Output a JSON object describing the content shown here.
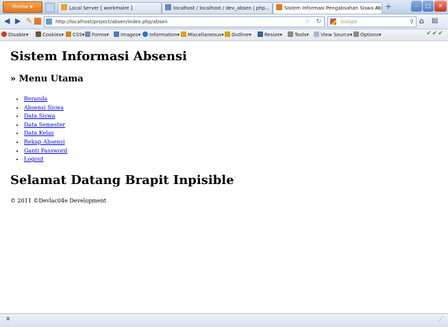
{
  "browser": {
    "menu_button": "Firefox",
    "menu_arrow": "▼",
    "tabs": [
      {
        "title": "Local Server [ workmaire ]"
      },
      {
        "title": "localhost / localhost / dev_absen | php..."
      },
      {
        "title": "Sistem Informasi Pengabsahan Siswa Absen..."
      }
    ],
    "new_tab": "+",
    "window_buttons": {
      "minimize": "–",
      "maximize": "□",
      "close": "✕"
    },
    "url": "http://localhost/project/absen/index.php/absen",
    "search_placeholder": "Google"
  },
  "devtoolbar": {
    "items": [
      {
        "label": "Disable▾",
        "color": "#d9341f"
      },
      {
        "label": "Cookies▾",
        "color": "#6a5a3a"
      },
      {
        "label": "CSS▾",
        "color": "#c98b1f"
      },
      {
        "label": "Forms▾",
        "color": "#7a8fa8"
      },
      {
        "label": "Images▾",
        "color": "#4a7bb8"
      },
      {
        "label": "Information▾",
        "color": "#2f6fc1"
      },
      {
        "label": "Miscellaneous▾",
        "color": "#e0a020"
      },
      {
        "label": "Outline▾",
        "color": "#d8a400"
      },
      {
        "label": "Resize▾",
        "color": "#3b5f9a"
      },
      {
        "label": "Tools▾",
        "color": "#8a8a8a"
      },
      {
        "label": "View Source▾",
        "color": "#a9b9cc"
      },
      {
        "label": "Options▾",
        "color": "#8a8a8a"
      }
    ],
    "status_ticks": "✔✔✔"
  },
  "page": {
    "title": "Sistem Informasi Absensi",
    "menu_heading": "» Menu Utama",
    "menu": [
      "Beranda",
      "Absensi Siswa",
      "Data Siswa",
      "Data Semester",
      "Data Kelas",
      "Rekap Absensi",
      "Ganti Password",
      "Logout"
    ],
    "welcome": "Selamat Datang Brapit Inpisible",
    "footer": "© 2011 ©Devlac04e Development"
  },
  "statusbar": {
    "close": "✕",
    "grip": "⋰"
  }
}
